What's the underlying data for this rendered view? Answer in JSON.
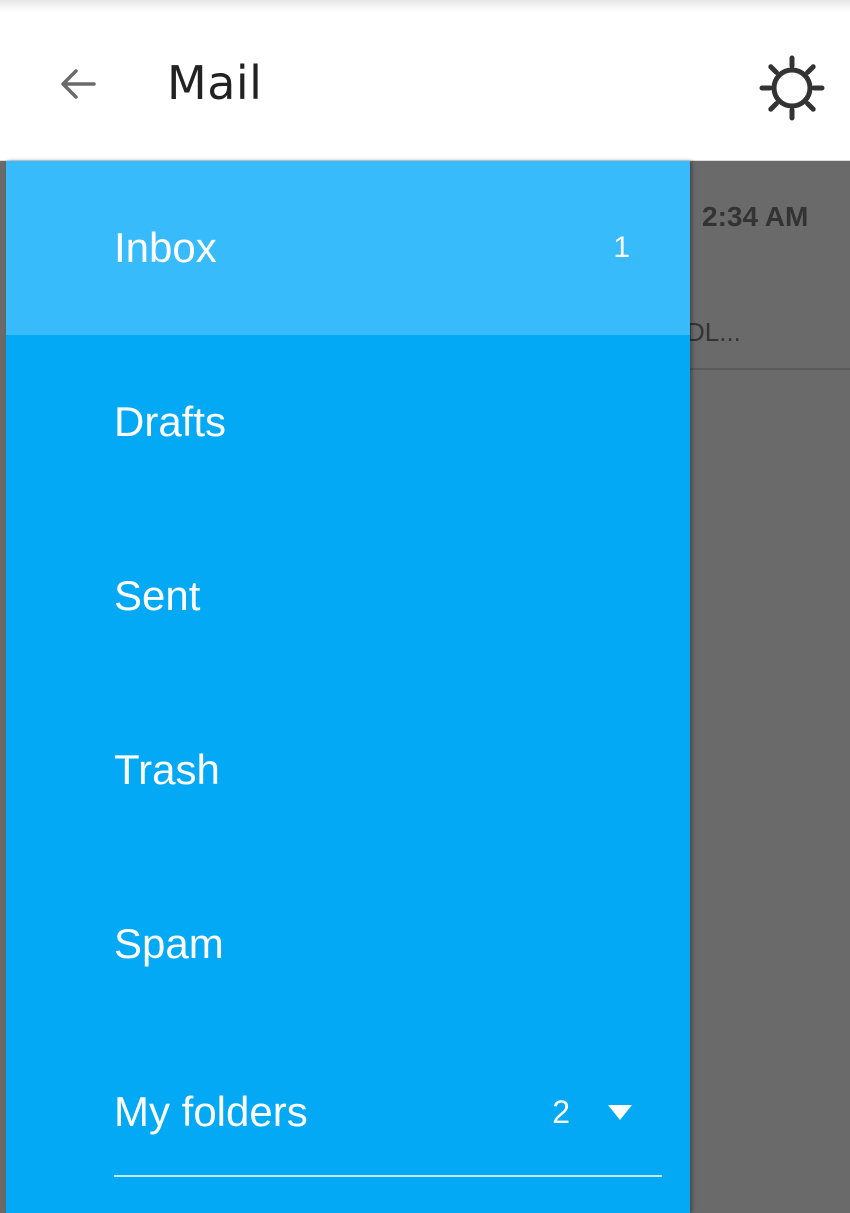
{
  "app_bar": {
    "title": "Mail",
    "back_icon": "arrow-left-icon",
    "settings_icon": "gear-icon"
  },
  "mail_list": {
    "time": "2:34 AM",
    "snippet": "DL..."
  },
  "drawer": {
    "items": [
      {
        "label": "Inbox",
        "count": "1",
        "selected": true
      },
      {
        "label": "Drafts"
      },
      {
        "label": "Sent"
      },
      {
        "label": "Trash"
      },
      {
        "label": "Spam"
      }
    ],
    "folders": {
      "label": "My folders",
      "count": "2",
      "icon": "caret-down-icon"
    }
  },
  "colors": {
    "drawer_bg": "#03a9f4",
    "selected_bg": "#38bbfb",
    "scrim": "#6a6a6a",
    "text_on_drawer": "#ffffff"
  }
}
